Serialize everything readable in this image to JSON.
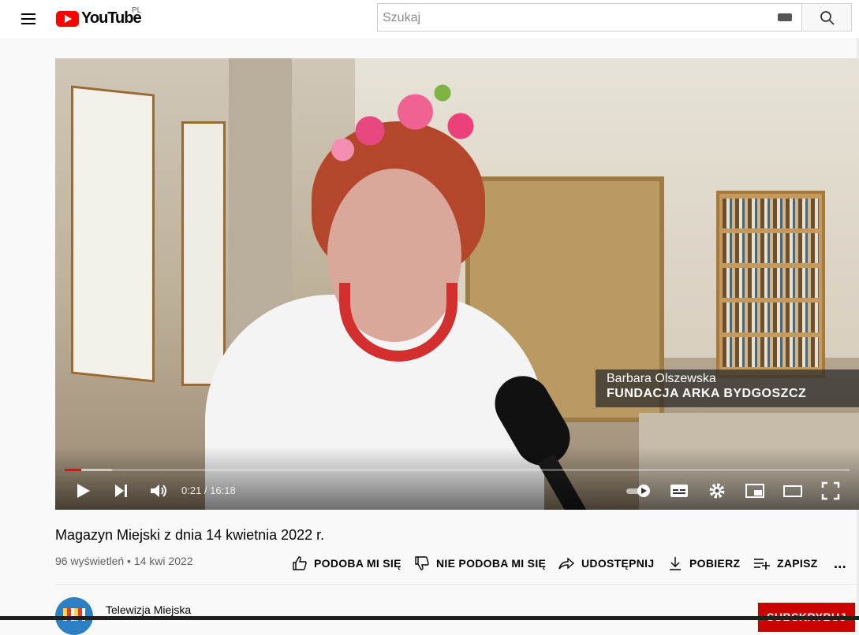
{
  "header": {
    "logo_text": "YouTube",
    "country_code": "PL",
    "search_placeholder": "Szukaj"
  },
  "player": {
    "overlay_name": "Barbara Olszewska",
    "overlay_org": "FUNDACJA ARKA BYDGOSZCZ",
    "time_display": "0:21 / 16:18",
    "progress_fraction": 0.0215,
    "buffered_fraction": 0.06
  },
  "video": {
    "title": "Magazyn Miejski z dnia 14 kwietnia 2022 r.",
    "meta": "96 wyświetleń • 14 kwi 2022"
  },
  "actions": {
    "like": "PODOBA MI SIĘ",
    "dislike": "NIE PODOBA MI SIĘ",
    "share": "UDOSTĘPNIJ",
    "download": "POBIERZ",
    "save": "ZAPISZ",
    "more": "..."
  },
  "channel": {
    "name": "Telewizja Miejska",
    "subscribe_label": "SUBSKRYBUJ"
  },
  "colors": {
    "brand_red": "#ff0000",
    "subscribe_red": "#cc0000"
  }
}
